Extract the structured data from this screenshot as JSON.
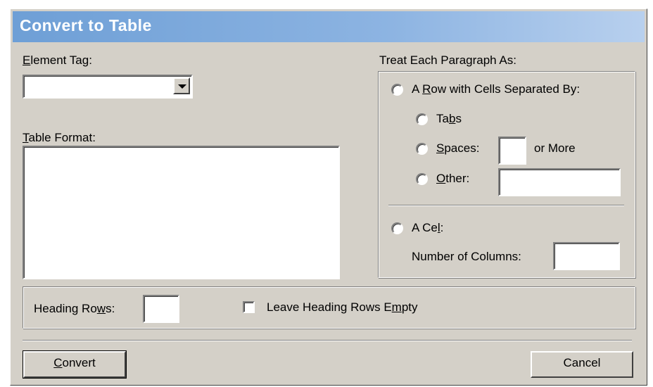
{
  "dialog": {
    "title": "Convert to Table"
  },
  "element_tag": {
    "label_pre": "",
    "label_mnemonic": "E",
    "label_post": "lement Tag:",
    "value": ""
  },
  "table_format": {
    "label_mnemonic": "T",
    "label_post": "able Format:",
    "items": []
  },
  "treat_group": {
    "label": "Treat Each Paragraph As:",
    "row_option": {
      "pre": "A ",
      "mnemonic": "R",
      "post": "ow with Cells Separated By:"
    },
    "tabs_option": {
      "pre": "Ta",
      "mnemonic": "b",
      "post": "s"
    },
    "spaces_option": {
      "pre": "",
      "mnemonic": "S",
      "post": "paces:"
    },
    "spaces_value": "",
    "or_more": "or More",
    "other_option": {
      "pre": "",
      "mnemonic": "O",
      "post": "ther:"
    },
    "other_value": "",
    "cell_option": {
      "pre": "A Ce",
      "mnemonic": "l",
      "post": ":"
    },
    "columns_label": "Number of Columns:",
    "columns_value": ""
  },
  "heading": {
    "rows_label": {
      "pre": "Heading Ro",
      "mnemonic": "w",
      "post": "s:"
    },
    "rows_value": "",
    "leave_empty": {
      "pre": "Leave Heading Rows E",
      "mnemonic": "m",
      "post": "pty"
    },
    "leave_empty_checked": false
  },
  "buttons": {
    "convert": {
      "pre": "",
      "mnemonic": "C",
      "post": "onvert"
    },
    "cancel": "Cancel"
  }
}
